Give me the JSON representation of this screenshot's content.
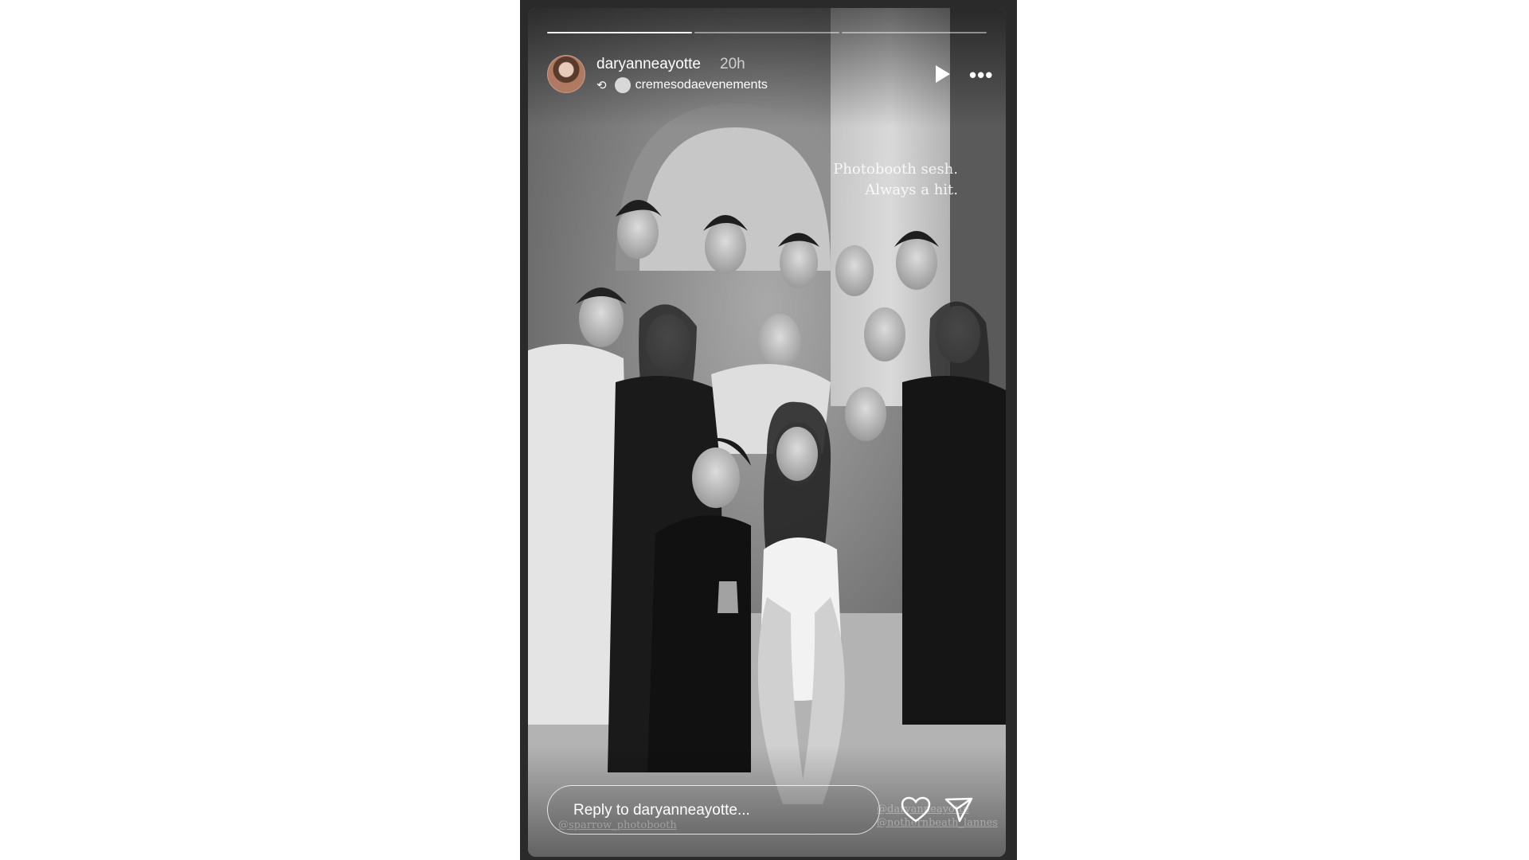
{
  "story": {
    "progress": {
      "segments": 3,
      "completed": 1
    },
    "header": {
      "username": "daryanneayotte",
      "time": "20h",
      "reposted_from": "cremesodaevenements",
      "play_icon": "play-icon",
      "more_icon": "more-icon"
    },
    "caption": {
      "line1": "Photobooth sesh.",
      "line2": "Always a hit."
    },
    "mentions": {
      "left": "@sparrow_photobooth",
      "right_line1": "@daryanneayotte",
      "right_line2": "@nothernbeath_lannes"
    },
    "reply": {
      "placeholder": "Reply to daryanneayotte..."
    },
    "actions": {
      "like_icon": "heart-icon",
      "share_icon": "send-icon"
    }
  }
}
